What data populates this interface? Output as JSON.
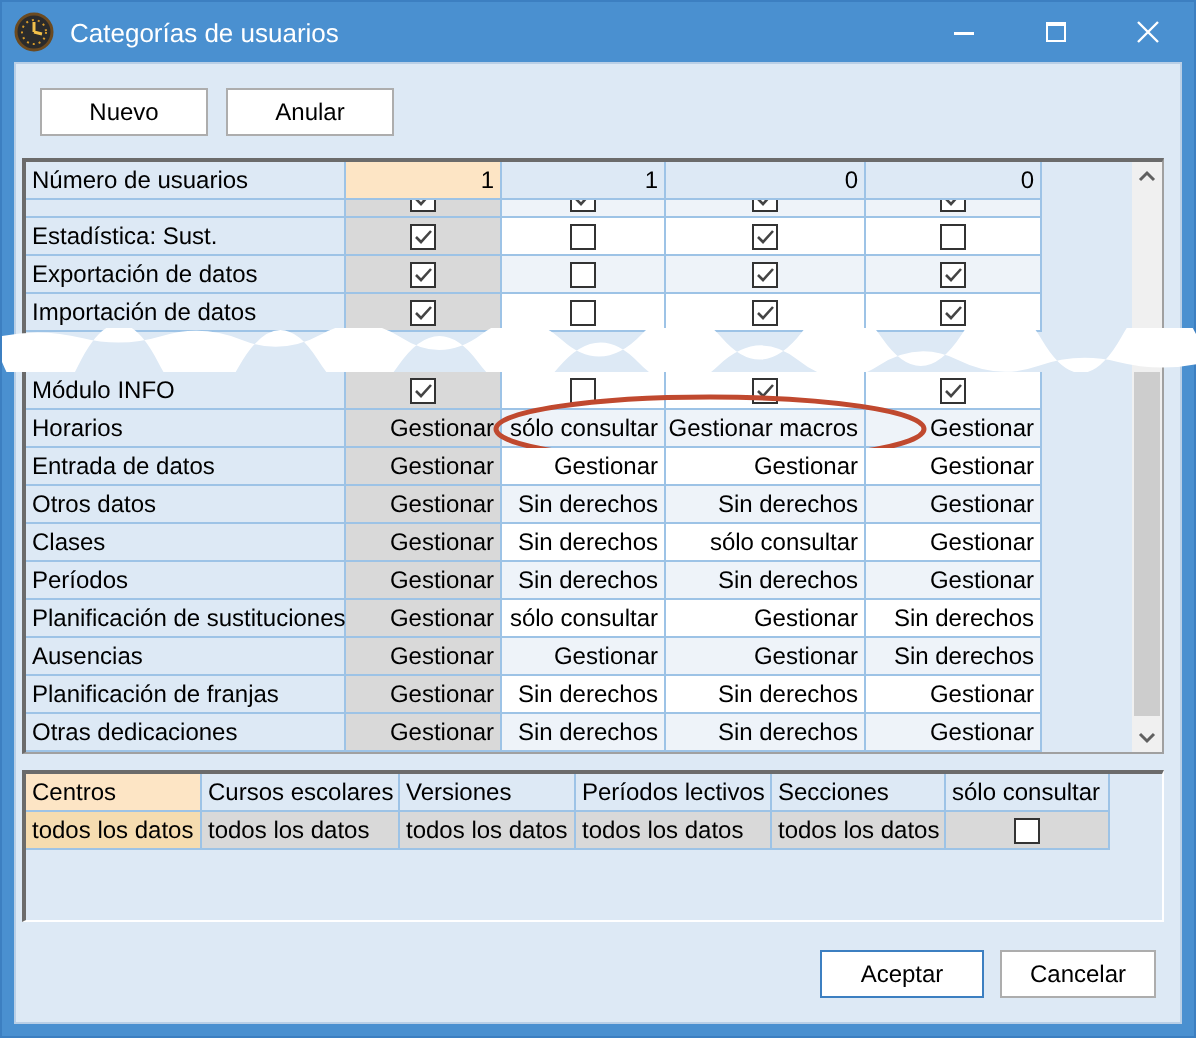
{
  "window": {
    "title": "Categorías de usuarios"
  },
  "toolbar": [
    "Nuevo",
    "Anular"
  ],
  "grid": {
    "header": {
      "label": "Número de usuarios",
      "values": [
        "1",
        "1",
        "0",
        "0"
      ]
    },
    "rows": [
      {
        "kind": "check_partial",
        "circled": false,
        "values": [
          true,
          true,
          true,
          true
        ]
      },
      {
        "kind": "check",
        "label": "Estadística: Sust.",
        "circled": false,
        "values": [
          true,
          false,
          true,
          false
        ]
      },
      {
        "kind": "check",
        "label": "Exportación de datos",
        "circled": false,
        "values": [
          true,
          false,
          true,
          true
        ]
      },
      {
        "kind": "check",
        "label": "Importación de datos",
        "circled": false,
        "values": [
          true,
          false,
          true,
          true
        ]
      },
      {
        "kind": "cut"
      },
      {
        "kind": "check",
        "label": "Módulo INFO",
        "circled": false,
        "values": [
          true,
          false,
          true,
          true
        ]
      },
      {
        "kind": "text",
        "label": "Horarios",
        "circled": true,
        "values": [
          "Gestionar",
          "sólo consultar",
          "Gestionar macros",
          "Gestionar"
        ]
      },
      {
        "kind": "text",
        "label": "Entrada de datos",
        "circled": false,
        "values": [
          "Gestionar",
          "Gestionar",
          "Gestionar",
          "Gestionar"
        ]
      },
      {
        "kind": "text",
        "label": "Otros datos",
        "circled": false,
        "values": [
          "Gestionar",
          "Sin derechos",
          "Sin derechos",
          "Gestionar"
        ]
      },
      {
        "kind": "text",
        "label": "Clases",
        "circled": false,
        "values": [
          "Gestionar",
          "Sin derechos",
          "sólo consultar",
          "Gestionar"
        ]
      },
      {
        "kind": "text",
        "label": "Períodos",
        "circled": false,
        "values": [
          "Gestionar",
          "Sin derechos",
          "Sin derechos",
          "Gestionar"
        ]
      },
      {
        "kind": "text",
        "label": "Planificación de sustituciones",
        "circled": false,
        "values": [
          "Gestionar",
          "sólo consultar",
          "Gestionar",
          "Sin derechos"
        ]
      },
      {
        "kind": "text",
        "label": "Ausencias",
        "circled": false,
        "values": [
          "Gestionar",
          "Gestionar",
          "Gestionar",
          "Sin derechos"
        ]
      },
      {
        "kind": "text",
        "label": "Planificación de franjas",
        "circled": false,
        "values": [
          "Gestionar",
          "Sin derechos",
          "Sin derechos",
          "Gestionar"
        ]
      },
      {
        "kind": "text",
        "label": "Otras dedicaciones",
        "circled": false,
        "values": [
          "Gestionar",
          "Sin derechos",
          "Sin derechos",
          "Gestionar"
        ]
      }
    ]
  },
  "scope_table": {
    "columns": [
      "Centros",
      "Cursos escolares",
      "Versiones",
      "Períodos lectivos",
      "Secciones",
      "sólo consultar"
    ],
    "row": {
      "cells": [
        "todos los datos",
        "todos los datos",
        "todos los datos",
        "todos los datos",
        "todos los datos"
      ],
      "read_only": false
    }
  },
  "buttons": [
    {
      "label": "Aceptar",
      "default": true
    },
    {
      "label": "Cancelar",
      "default": false
    }
  ]
}
